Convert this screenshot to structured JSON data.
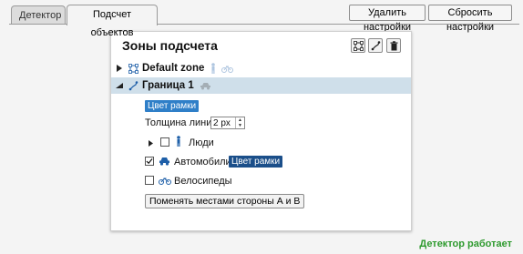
{
  "tabs": [
    {
      "label": "Детектор",
      "active": false
    },
    {
      "label": "Подсчет объектов",
      "active": true
    }
  ],
  "toolbar": {
    "delete_settings": "Удалить настройки",
    "reset_settings": "Сбросить настройки"
  },
  "panel": {
    "title": "Зоны подсчета",
    "tools": [
      "add-zone-icon",
      "add-line-icon",
      "trash-icon"
    ],
    "zones": [
      {
        "label": "Default zone",
        "expanded": false,
        "selected": false,
        "icons": [
          "person-icon",
          "bicycle-icon"
        ]
      },
      {
        "label": "Граница 1",
        "expanded": true,
        "selected": true,
        "icons": [
          "car-icon"
        ]
      }
    ],
    "frame_color_label": "Цвет рамки",
    "line_thickness_label": "Толщина линии",
    "line_thickness_value": "2 px",
    "options": [
      {
        "label": "Люди",
        "checked": false,
        "icon": "person-icon",
        "expandable": true
      },
      {
        "label": "Автомобили",
        "checked": true,
        "icon": "car-icon",
        "color_label": "Цвет рамки"
      },
      {
        "label": "Велосипеды",
        "checked": false,
        "icon": "bicycle-icon"
      }
    ],
    "swap_button": "Поменять местами стороны А и В"
  },
  "status": {
    "text": "Детектор работает",
    "color": "#2e9a2e"
  },
  "colors": {
    "accent": "#2f7fc8",
    "selection": "#cfdfea",
    "icon_blue": "#1e5fa8"
  }
}
